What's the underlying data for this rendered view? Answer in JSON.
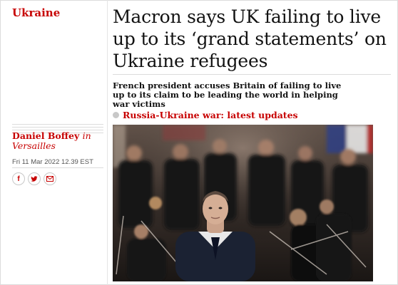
{
  "section": {
    "label": "Ukraine"
  },
  "headline": "Macron says UK failing to live up to its ‘grand statements’ on Ukraine refugees",
  "standfirst": "French president accuses Britain of failing to live up to its claim to be leading the world in helping war victims",
  "live_link": {
    "label": "Russia-Ukraine war: latest updates"
  },
  "byline": {
    "author": "Daniel Boffey",
    "in_word": "in",
    "location": "Versailles"
  },
  "dateline": "Fri 11 Mar 2022 12.39 EST",
  "share": {
    "facebook_glyph": "f",
    "twitter_glyph": "ᵮ",
    "email_icon": "envelope-icon"
  },
  "colors": {
    "accent": "#c70000",
    "text": "#121212",
    "meta": "#555555",
    "rule": "#dcdcdc"
  }
}
